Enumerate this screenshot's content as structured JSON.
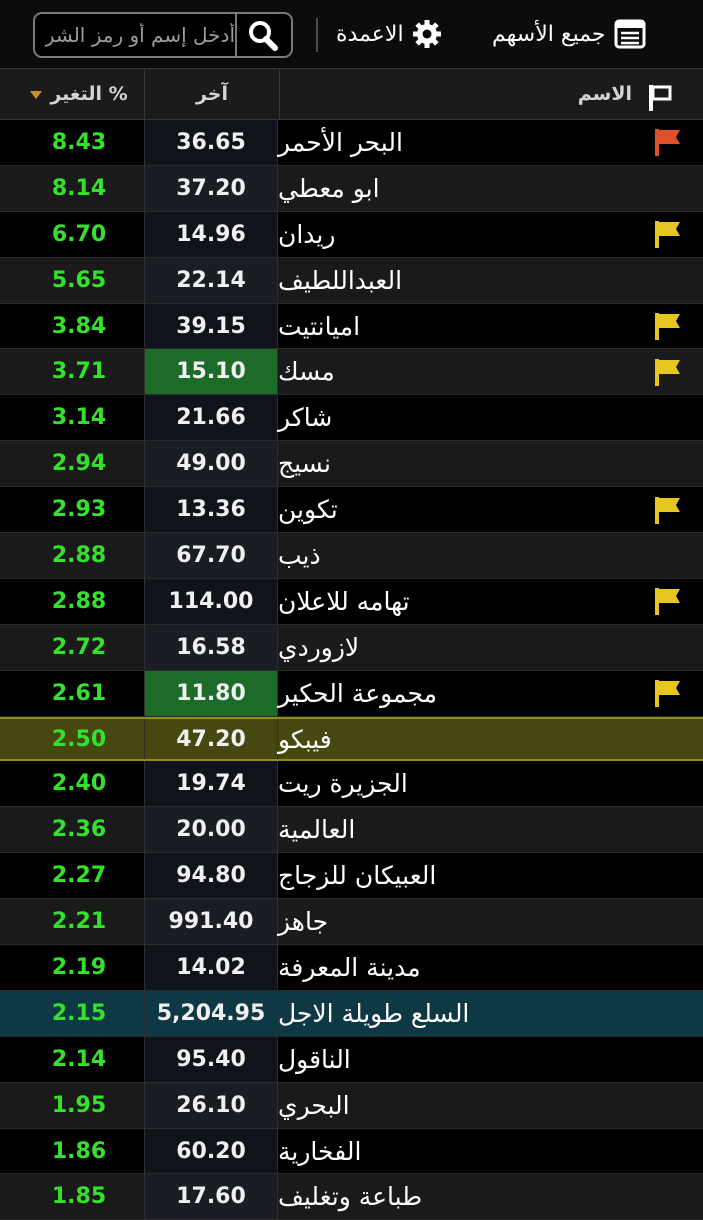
{
  "header": {
    "search_placeholder": "أدخل إسم أو رمز الشركة",
    "columns_label": "الاعمدة",
    "all_stocks_label": "جميع الأسهم"
  },
  "table": {
    "headers": {
      "name": "الاسم",
      "last": "آخر",
      "change": "التغير %"
    },
    "sort_indicator": "descending",
    "flag_colors": {
      "red": "#e0502a",
      "yellow": "#e8c622"
    },
    "rows": [
      {
        "name": "البحر الأحمر",
        "last": "36.65",
        "change": "8.43",
        "flag": "red",
        "highlight": ""
      },
      {
        "name": "ابو معطي",
        "last": "37.20",
        "change": "8.14",
        "flag": "",
        "highlight": ""
      },
      {
        "name": "ريدان",
        "last": "14.96",
        "change": "6.70",
        "flag": "yellow",
        "highlight": ""
      },
      {
        "name": "العبداللطيف",
        "last": "22.14",
        "change": "5.65",
        "flag": "",
        "highlight": ""
      },
      {
        "name": "اميانتيت",
        "last": "39.15",
        "change": "3.84",
        "flag": "yellow",
        "highlight": ""
      },
      {
        "name": "مسك",
        "last": "15.10",
        "change": "3.71",
        "flag": "yellow",
        "highlight": "",
        "last_green": true
      },
      {
        "name": "شاكر",
        "last": "21.66",
        "change": "3.14",
        "flag": "",
        "highlight": ""
      },
      {
        "name": "نسيج",
        "last": "49.00",
        "change": "2.94",
        "flag": "",
        "highlight": ""
      },
      {
        "name": "تكوين",
        "last": "13.36",
        "change": "2.93",
        "flag": "yellow",
        "highlight": ""
      },
      {
        "name": "ذيب",
        "last": "67.70",
        "change": "2.88",
        "flag": "",
        "highlight": ""
      },
      {
        "name": "تهامه للاعلان",
        "last": "114.00",
        "change": "2.88",
        "flag": "yellow",
        "highlight": ""
      },
      {
        "name": "لازوردي",
        "last": "16.58",
        "change": "2.72",
        "flag": "",
        "highlight": ""
      },
      {
        "name": "مجموعة الحكير",
        "last": "11.80",
        "change": "2.61",
        "flag": "yellow",
        "highlight": "",
        "last_green": true
      },
      {
        "name": "فيبكو",
        "last": "47.20",
        "change": "2.50",
        "flag": "",
        "highlight": "yellow"
      },
      {
        "name": "الجزيرة ريت",
        "last": "19.74",
        "change": "2.40",
        "flag": "",
        "highlight": ""
      },
      {
        "name": "العالمية",
        "last": "20.00",
        "change": "2.36",
        "flag": "",
        "highlight": ""
      },
      {
        "name": "العبيكان للزجاج",
        "last": "94.80",
        "change": "2.27",
        "flag": "",
        "highlight": ""
      },
      {
        "name": "جاهز",
        "last": "991.40",
        "change": "2.21",
        "flag": "",
        "highlight": ""
      },
      {
        "name": "مدينة المعرفة",
        "last": "14.02",
        "change": "2.19",
        "flag": "",
        "highlight": ""
      },
      {
        "name": "السلع طويلة الاجل",
        "last": "5,204.95",
        "change": "2.15",
        "flag": "",
        "highlight": "blue"
      },
      {
        "name": "الناقول",
        "last": "95.40",
        "change": "2.14",
        "flag": "",
        "highlight": ""
      },
      {
        "name": "البحري",
        "last": "26.10",
        "change": "1.95",
        "flag": "",
        "highlight": ""
      },
      {
        "name": "الفخارية",
        "last": "60.20",
        "change": "1.86",
        "flag": "",
        "highlight": ""
      },
      {
        "name": "طباعة وتغليف",
        "last": "17.60",
        "change": "1.85",
        "flag": "",
        "highlight": ""
      }
    ]
  }
}
